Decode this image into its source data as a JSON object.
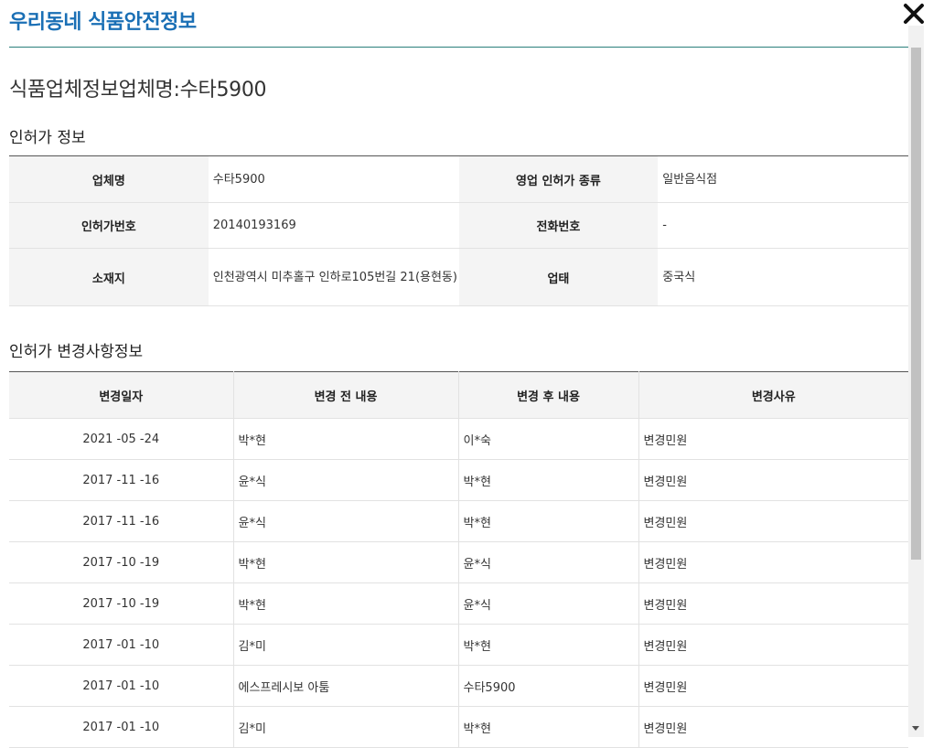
{
  "header": {
    "title": "우리동네 식품안전정보"
  },
  "page_title": "식품업체정보업체명:수타5900",
  "license_section": {
    "title": "인허가 정보",
    "rows": [
      {
        "label1": "업체명",
        "value1": "수타5900",
        "label2": "영업 인허가 종류",
        "value2": "일반음식점"
      },
      {
        "label1": "인허가번호",
        "value1": "20140193169",
        "label2": "전화번호",
        "value2": "-"
      },
      {
        "label1": "소재지",
        "value1": "인천광역시 미추홀구 인하로105번길 21(용현동)",
        "label2": "업태",
        "value2": "중국식"
      }
    ]
  },
  "history_section": {
    "title": "인허가 변경사항정보",
    "columns": [
      "변경일자",
      "변경 전 내용",
      "변경 후 내용",
      "변경사유"
    ],
    "rows": [
      {
        "date": "2021 -05 -24",
        "before": "박*현",
        "after": "이*숙",
        "reason": "변경민원"
      },
      {
        "date": "2017 -11 -16",
        "before": "윤*식",
        "after": "박*현",
        "reason": "변경민원"
      },
      {
        "date": "2017 -11 -16",
        "before": "윤*식",
        "after": "박*현",
        "reason": "변경민원"
      },
      {
        "date": "2017 -10 -19",
        "before": "박*현",
        "after": "윤*식",
        "reason": "변경민원"
      },
      {
        "date": "2017 -10 -19",
        "before": "박*현",
        "after": "윤*식",
        "reason": "변경민원"
      },
      {
        "date": "2017 -01 -10",
        "before": "김*미",
        "after": "박*현",
        "reason": "변경민원"
      },
      {
        "date": "2017 -01 -10",
        "before": "에스프레시보 아툼",
        "after": "수타5900",
        "reason": "변경민원"
      },
      {
        "date": "2017 -01 -10",
        "before": "김*미",
        "after": "박*현",
        "reason": "변경민원"
      }
    ]
  },
  "colors": {
    "title_blue": "#1a6fb5",
    "header_line": "#2a7f7b",
    "th_bg": "#f4f4f4"
  },
  "icons": {
    "close": "close-icon",
    "scroll_down": "scroll-down-arrow-icon"
  }
}
